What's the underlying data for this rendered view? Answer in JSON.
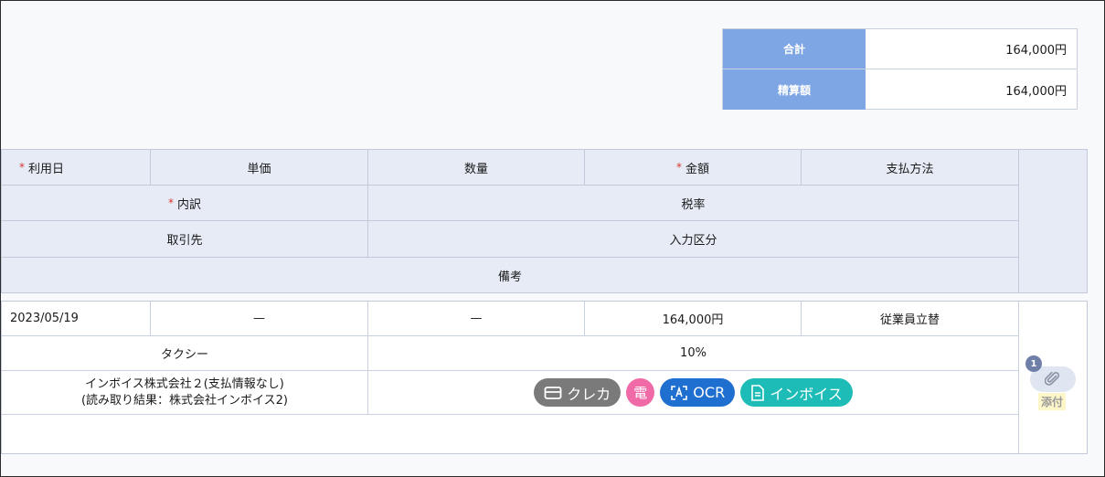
{
  "summary": {
    "total_label": "合計",
    "total_value": "164,000円",
    "settle_label": "精算額",
    "settle_value": "164,000円"
  },
  "header": {
    "required_mark": "*",
    "use_date": "利用日",
    "unit_price": "単価",
    "quantity": "数量",
    "amount": "金額",
    "payment_method": "支払方法",
    "breakdown": "内訳",
    "tax_rate": "税率",
    "vendor": "取引先",
    "input_type": "入力区分",
    "remarks": "備考"
  },
  "row": {
    "use_date": "2023/05/19",
    "unit_price": "—",
    "quantity": "—",
    "amount": "164,000円",
    "payment_method": "従業員立替",
    "breakdown": "タクシー",
    "tax_rate": "10%",
    "vendor_line1": "インボイス株式会社２(支払情報なし)",
    "vendor_line2": "(読み取り結果：株式会社インボイス2)",
    "remarks": ""
  },
  "badges": {
    "card": "クレカ",
    "den": "電",
    "ocr": "OCR",
    "invoice": "インボイス"
  },
  "attachment": {
    "count": "1",
    "label": "添付"
  },
  "colors": {
    "summary_label_bg": "#7ea6e4",
    "header_bg": "#e6ebf5",
    "required": "#d9362b",
    "badge_card": "#7a7a7a",
    "badge_den": "#ef6aa6",
    "badge_ocr": "#1f6fd1",
    "badge_invoice": "#1ebcb6"
  }
}
